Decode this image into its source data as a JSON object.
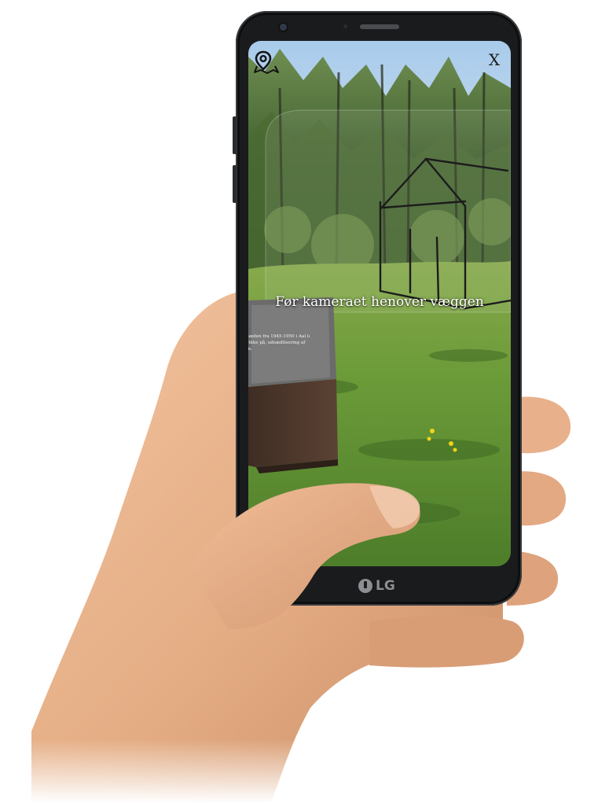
{
  "app": {
    "hint_text": "Før kameraet henover væggen",
    "close_label": "X",
    "map_button_icon": "map-pin-icon",
    "close_button_icon": "close-icon"
  },
  "sign": {
    "lines": [
      "sæden fra 1945-1950 i Aal lejren.",
      "rikke på, udsædlisering af",
      "m."
    ]
  },
  "device": {
    "brand": "LG"
  },
  "colors": {
    "bezel": "#1a1b1d",
    "hint_text": "#ffffff",
    "grass": "#5f8f2e",
    "sky": "#bcd6ee",
    "skin": "#e4ac83"
  }
}
